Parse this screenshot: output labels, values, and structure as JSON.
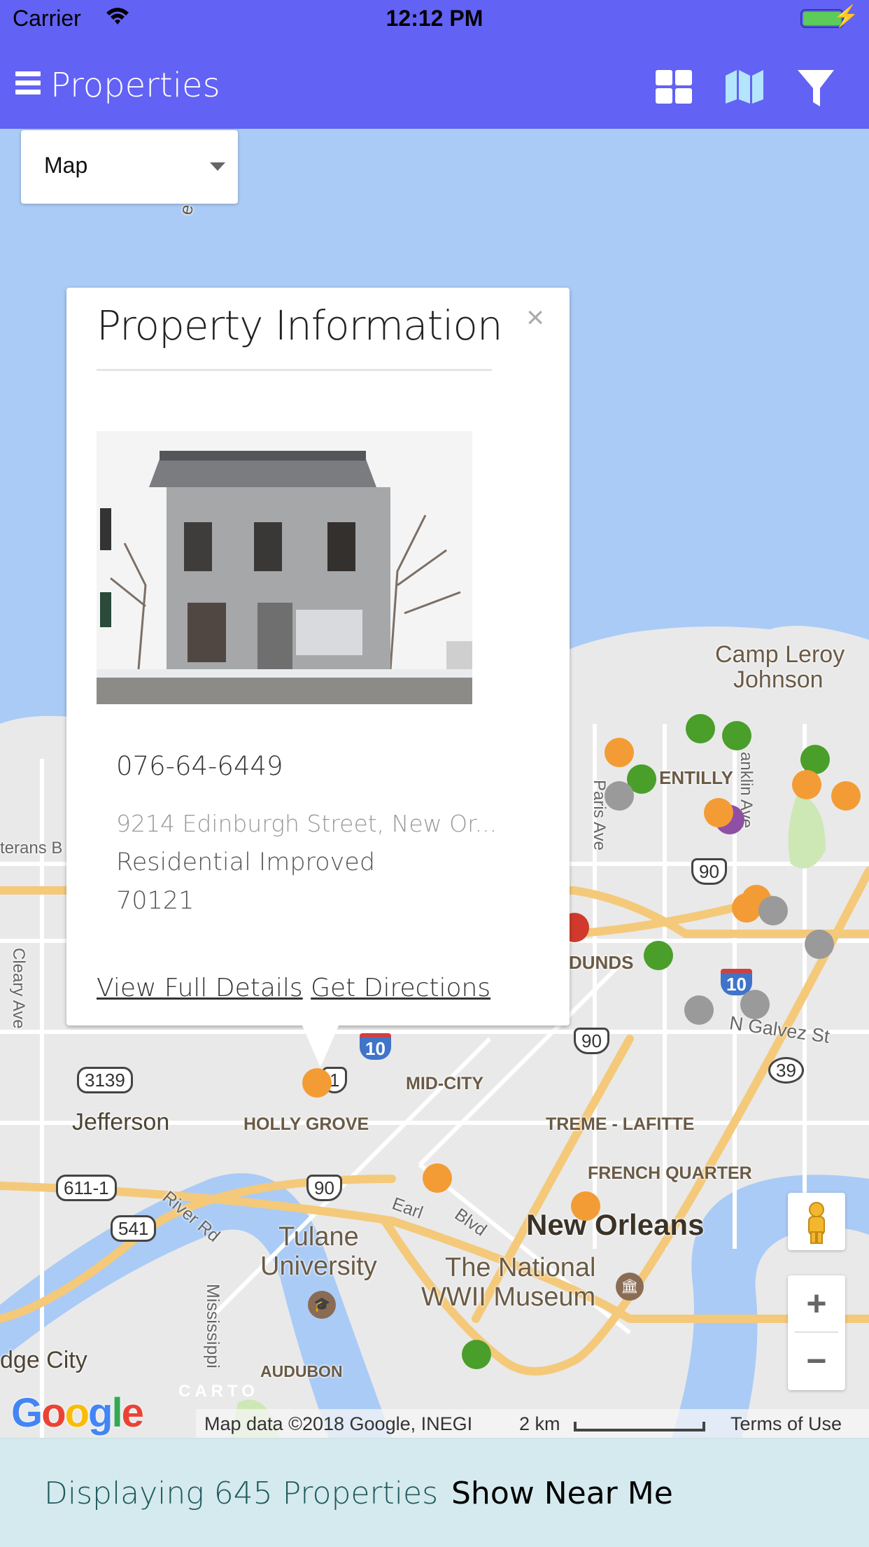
{
  "status_bar": {
    "carrier": "Carrier",
    "time": "12:12 PM",
    "wifi_icon": "wifi-icon",
    "battery_icon": "battery-charging-icon"
  },
  "header": {
    "title": "Properties",
    "menu_icon": "hamburger-menu-icon",
    "actions": [
      {
        "name": "grid-view",
        "icon": "grid-icon"
      },
      {
        "name": "map-view",
        "icon": "map-icon",
        "active": true
      },
      {
        "name": "filter",
        "icon": "filter-icon"
      }
    ],
    "active_color": "#b3e5fc",
    "bar_color": "#6262f4"
  },
  "view_select": {
    "selected": "Map"
  },
  "popup": {
    "title": "Property Information",
    "close_label": "×",
    "photo_alt": "Abandoned two-story stone building",
    "parcel_id": "076-64-6449",
    "address": "9214 Edinburgh Street, New Or...",
    "type": "Residential Improved",
    "zip": "70121",
    "links": {
      "details": "View Full Details",
      "directions": "Get Directions"
    }
  },
  "map": {
    "labels": {
      "lake": "e Pontch",
      "camp": "Camp Leroy",
      "camp2": "Johnson",
      "gentilly": "ENTILLY",
      "paris": "Paris Ave",
      "franklin": "anklin Ave",
      "grounds": "DUNDS",
      "galvez": "N Galvez St",
      "veterans": "terans B",
      "cleary": "Cleary Ave",
      "jefferson": "Jefferson",
      "holly": "HOLLY GROVE",
      "midcity": "MID-CITY",
      "treme": "TREME - LAFITTE",
      "french": "FRENCH QUARTER",
      "neworleans": "New Orleans",
      "tulane": "Tulane",
      "tulane2": "University",
      "wwii": "The National",
      "wwii2": "WWII Museum",
      "river": "River Rd",
      "earhart": "Earl",
      "blvd": "Blvd",
      "mississippi": "Mississippi",
      "bridge": "dge City",
      "audubon": "AUDUBON",
      "carto": "CARTO"
    },
    "shields": {
      "r3139": "3139",
      "r611": "611-1",
      "r541": "541",
      "r90a": "90",
      "r90b": "90",
      "r90c": "90",
      "r39": "39",
      "i10a": "10",
      "i10b": "10",
      "us1": "1"
    },
    "marker_colors": {
      "orange": "#f39c35",
      "green": "#4a9e2a",
      "grey": "#9a9a9a",
      "purple": "#8e4fa5",
      "red": "#d0392b"
    },
    "attribution": "Map data ©2018 Google, INEGI",
    "scale": "2 km",
    "terms": "Terms of Use",
    "google_logo": "Google",
    "zoom_in": "+",
    "zoom_out": "−"
  },
  "footer": {
    "count_text": "Displaying 645 Properties",
    "near_me": "Show Near Me"
  }
}
